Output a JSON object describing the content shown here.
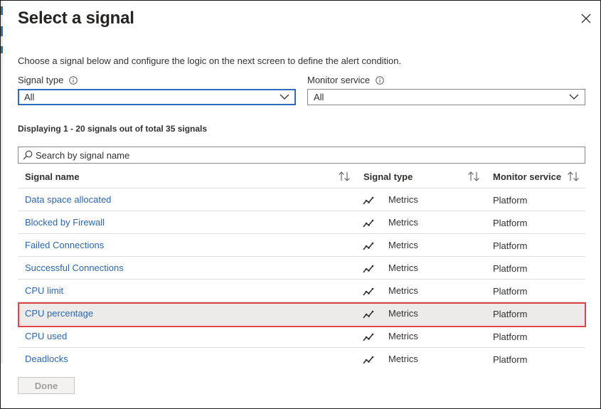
{
  "panel": {
    "title": "Select a signal",
    "description": "Choose a signal below and configure the logic on the next screen to define the alert condition."
  },
  "filters": {
    "signal_type": {
      "label": "Signal type",
      "value": "All"
    },
    "monitor_service": {
      "label": "Monitor service",
      "value": "All"
    }
  },
  "summary": "Displaying 1 - 20 signals out of total 35 signals",
  "search": {
    "placeholder": "Search by signal name"
  },
  "table": {
    "columns": [
      "Signal name",
      "Signal type",
      "Monitor service"
    ],
    "rows": [
      {
        "name": "Data space allocated",
        "type": "Metrics",
        "service": "Platform",
        "selected": false
      },
      {
        "name": "Blocked by Firewall",
        "type": "Metrics",
        "service": "Platform",
        "selected": false
      },
      {
        "name": "Failed Connections",
        "type": "Metrics",
        "service": "Platform",
        "selected": false
      },
      {
        "name": "Successful Connections",
        "type": "Metrics",
        "service": "Platform",
        "selected": false
      },
      {
        "name": "CPU limit",
        "type": "Metrics",
        "service": "Platform",
        "selected": false
      },
      {
        "name": "CPU percentage",
        "type": "Metrics",
        "service": "Platform",
        "selected": true
      },
      {
        "name": "CPU used",
        "type": "Metrics",
        "service": "Platform",
        "selected": false
      },
      {
        "name": "Deadlocks",
        "type": "Metrics",
        "service": "Platform",
        "selected": false
      }
    ]
  },
  "footer": {
    "done_label": "Done"
  },
  "icons": {
    "close": "close-icon",
    "info": "info-icon",
    "chevron": "chevron-down-icon",
    "search": "search-icon",
    "sort": "sort-icon",
    "metric": "metrics-icon"
  },
  "colors": {
    "link": "#2a67b0",
    "focus_border": "#2d6bbf",
    "selected_row": "#edebe9",
    "highlight_outline": "#e0424a"
  }
}
